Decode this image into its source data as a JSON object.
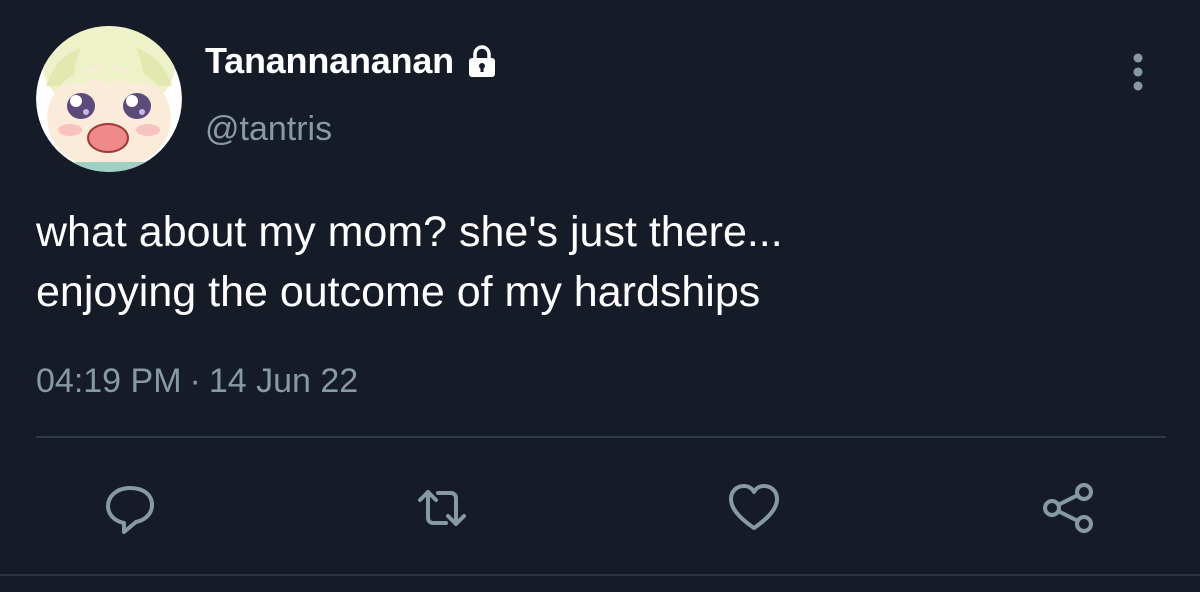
{
  "user": {
    "display_name": "Tanannananan",
    "handle": "@tantris",
    "protected": true
  },
  "tweet": {
    "lines": [
      "what about my mom? she's just there...",
      "enjoying the outcome of my hardships"
    ],
    "time": "04:19 PM",
    "separator": "·",
    "date": "14 Jun 22"
  },
  "icons": {
    "avatar": "anime-face-avatar",
    "lock": "lock-icon",
    "more": "more-vertical-icon",
    "reply": "reply-icon",
    "retweet": "retweet-icon",
    "like": "heart-icon",
    "share": "share-icon"
  },
  "colors": {
    "background": "#151c27",
    "text": "#ffffff",
    "secondary_text": "#8899a6",
    "icon": "#8899a6",
    "divider": "#2f3b47"
  }
}
